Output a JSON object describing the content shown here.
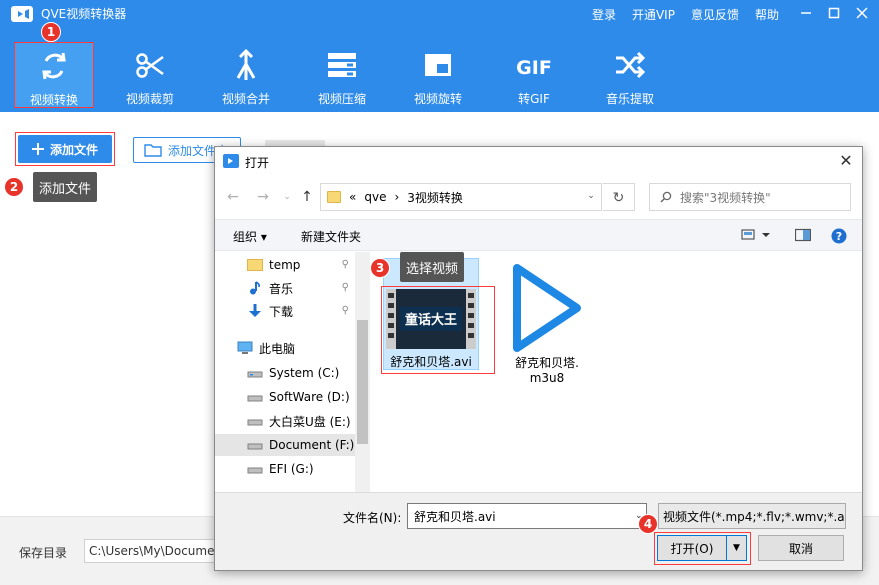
{
  "app": {
    "title": "QVE视频转换器",
    "top_links": [
      "登录",
      "开通VIP",
      "意见反馈",
      "帮助"
    ],
    "window_controls": [
      "minimize-icon",
      "maximize-icon",
      "close-icon"
    ]
  },
  "toolbar": {
    "items": [
      {
        "label": "视频转换",
        "icon": "convert-icon",
        "active": true
      },
      {
        "label": "视频裁剪",
        "icon": "scissors-icon"
      },
      {
        "label": "视频合并",
        "icon": "merge-icon"
      },
      {
        "label": "视频压缩",
        "icon": "compress-icon"
      },
      {
        "label": "视频旋转",
        "icon": "rotate-icon"
      },
      {
        "label": "转GIF",
        "icon": "gif-icon",
        "icon_text": "GIF"
      },
      {
        "label": "音乐提取",
        "icon": "shuffle-icon"
      }
    ]
  },
  "main": {
    "add_file_label": "添加文件",
    "add_folder_label": "添加文件夹"
  },
  "annotations": {
    "badges": [
      "1",
      "2",
      "3",
      "4"
    ],
    "tip_add_file": "添加文件",
    "tip_select_video": "选择视频",
    "highlight_color": "#ff3b3b",
    "badge_color": "#e8332a"
  },
  "footer": {
    "save_label": "保存目录",
    "save_path": "C:\\Users\\My\\Documents"
  },
  "dialog": {
    "title": "打开",
    "address": {
      "prefix": "«",
      "segments": [
        "qve",
        "3视频转换"
      ],
      "separator": "›"
    },
    "search_placeholder": "搜索\"3视频转换\"",
    "commands": {
      "organize": "组织 ▾",
      "new_folder": "新建文件夹"
    },
    "nav_items": [
      {
        "label": "temp",
        "icon": "folder-icon",
        "pinned": true
      },
      {
        "label": "音乐",
        "icon": "music-icon",
        "pinned": true
      },
      {
        "label": "下载",
        "icon": "download-icon",
        "pinned": true
      },
      {
        "label": "此电脑",
        "icon": "computer-icon"
      },
      {
        "label": "System (C:)",
        "icon": "drive-icon"
      },
      {
        "label": "SoftWare (D:)",
        "icon": "drive-icon"
      },
      {
        "label": "大白菜U盘 (E:)",
        "icon": "drive-icon"
      },
      {
        "label": "Document (F:)",
        "icon": "drive-icon",
        "selected": true
      },
      {
        "label": "EFI (G:)",
        "icon": "drive-icon"
      }
    ],
    "files": [
      {
        "name": "舒克和贝塔.avi",
        "icon": "video-thumbnail-icon",
        "thumb_text": "童话大王",
        "selected": true
      },
      {
        "name_line1": "舒克和贝塔.",
        "name_line2": "m3u8",
        "icon": "play-icon"
      }
    ],
    "filename_label": "文件名(N):",
    "filename_value": "舒克和贝塔.avi",
    "filter_value": "视频文件(*.mp4;*.flv;*.wmv;*.a",
    "open_label": "打开(O)",
    "cancel_label": "取消"
  },
  "colors": {
    "primary": "#2f8bea",
    "active_tool": "#45a0f1",
    "selection": "#cce8ff"
  }
}
